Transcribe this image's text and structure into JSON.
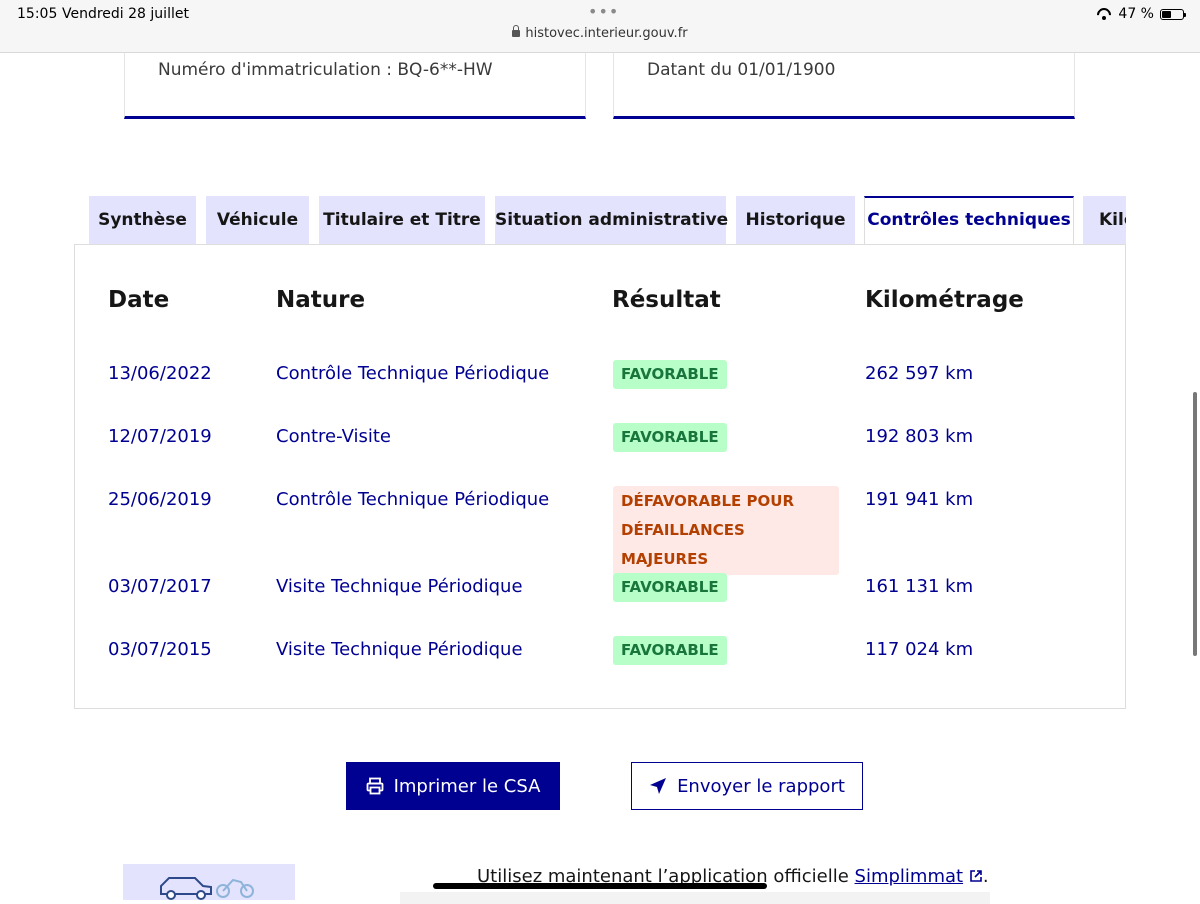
{
  "status_bar": {
    "time": "15:05",
    "date": "Vendredi 28 juillet",
    "url": "histovec.interieur.gouv.fr",
    "battery": "47 %",
    "battery_level": 0.47
  },
  "cards": {
    "registration": "Numéro d'immatriculation : BQ-6**-HW",
    "dated": "Datant du 01/01/1900"
  },
  "tabs": [
    {
      "label": "Synthèse"
    },
    {
      "label": "Véhicule"
    },
    {
      "label": "Titulaire et Titre"
    },
    {
      "label": "Situation administrative"
    },
    {
      "label": "Historique"
    },
    {
      "label": "Contrôles techniques"
    },
    {
      "label": "Kilo"
    }
  ],
  "table": {
    "headers": [
      "Date",
      "Nature",
      "Résultat",
      "Kilométrage"
    ],
    "rows": [
      {
        "date": "13/06/2022",
        "nature": "Contrôle Technique Périodique",
        "result": "FAVORABLE",
        "km": "262 597 km"
      },
      {
        "date": "12/07/2019",
        "nature": "Contre-Visite",
        "result": "FAVORABLE",
        "km": "192 803 km"
      },
      {
        "date": "25/06/2019",
        "nature": "Contrôle Technique Périodique",
        "result_line1": "DÉFAVORABLE POUR",
        "result_line2": "DÉFAILLANCES MAJEURES",
        "km": "191 941 km"
      },
      {
        "date": "03/07/2017",
        "nature": "Visite Technique Périodique",
        "result": "FAVORABLE",
        "km": "161 131 km"
      },
      {
        "date": "03/07/2015",
        "nature": "Visite Technique Périodique",
        "result": "FAVORABLE",
        "km": "117 024 km"
      }
    ]
  },
  "buttons": {
    "print": "Imprimer le CSA",
    "send": "Envoyer le rapport"
  },
  "footer": {
    "promo_text": "Utilisez maintenant l’application officielle",
    "promo_link": "Simplimmat",
    "promo_end": "."
  },
  "colors": {
    "primary": "#000091",
    "tab_bg": "#e3e3fd",
    "success_bg": "#b8fec9",
    "success_text": "#18753c",
    "error_bg": "#ffe9e6",
    "error_text": "#b34000"
  },
  "icons": [
    "lock-icon",
    "wifi-icon",
    "battery-icon",
    "printer-icon",
    "send-icon",
    "external-link-icon",
    "car-icon",
    "motorcycle-icon"
  ]
}
